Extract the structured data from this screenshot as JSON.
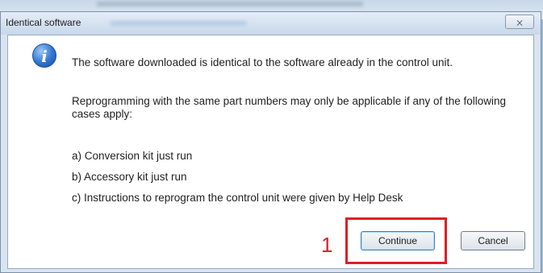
{
  "window": {
    "title": "Identical software",
    "close_glyph": "⨯"
  },
  "message": {
    "icon": "info-icon",
    "line1": "The software downloaded is identical to the software already in the control unit.",
    "line2": "Reprogramming with the same part numbers may only be applicable if any of the following cases apply:",
    "case_a": "a) Conversion kit just run",
    "case_b": "b) Accessory kit just run",
    "case_c": "c) Instructions to reprogram the control unit were given by Help Desk"
  },
  "annotation": {
    "number": "1",
    "color": "#e01e24"
  },
  "buttons": {
    "continue_label": "Continue",
    "cancel_label": "Cancel"
  }
}
